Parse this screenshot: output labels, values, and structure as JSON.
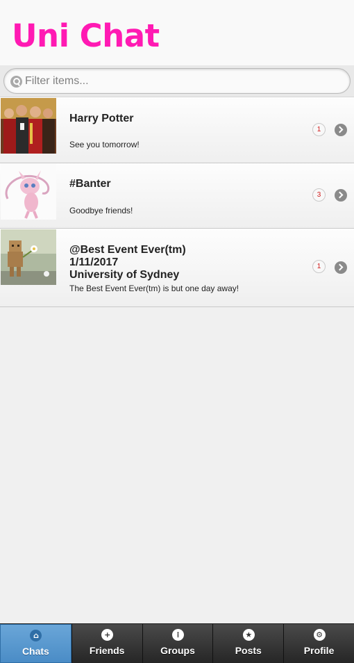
{
  "header": {
    "title": "Uni Chat"
  },
  "filter": {
    "placeholder": "Filter items..."
  },
  "chats": [
    {
      "title": "Harry Potter",
      "message": "See you tomorrow!",
      "count": "1",
      "image_icon": "group-photo-icon"
    },
    {
      "title": "#Banter",
      "message": "Goodbye friends!",
      "count": "3",
      "image_icon": "pink-creature-icon"
    },
    {
      "title": "@Best Event Ever(tm)\n1/11/2017\nUniversity of Sydney",
      "message": "The Best Event Ever(tm) is but one day away!",
      "count": "1",
      "image_icon": "cardboard-robot-icon"
    }
  ],
  "tabs": [
    {
      "label": "Chats",
      "icon": "home-icon",
      "active": true
    },
    {
      "label": "Friends",
      "icon": "plus-icon",
      "active": false
    },
    {
      "label": "Groups",
      "icon": "grid-icon",
      "active": false
    },
    {
      "label": "Posts",
      "icon": "star-icon",
      "active": false
    },
    {
      "label": "Profile",
      "icon": "gear-icon",
      "active": false
    }
  ],
  "colors": {
    "title": "#ff1ab3",
    "active_tab": "#5a9ad0",
    "badge_text": "#d01818"
  }
}
